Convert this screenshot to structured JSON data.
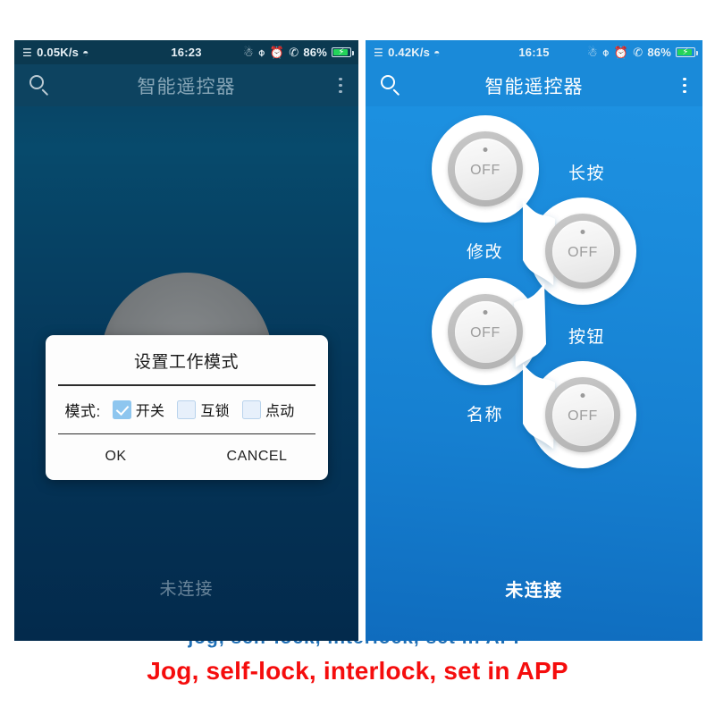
{
  "caption": {
    "text": "Jog, self-lock, interlock, set in APP",
    "color": "#f50d0d"
  },
  "clipped_text": {
    "text": "jog, self-lock, interlock, set in APP"
  },
  "phones": {
    "left": {
      "status_bar": {
        "network_speed": "0.05K/s",
        "signal_icon": "signal-bars-icon",
        "wifi_icon": "wifi-icon",
        "time": "16:23",
        "bluetooth_icon": "bluetooth-icon",
        "mute_icon": "mute-icon",
        "alarm_icon": "alarm-icon",
        "call_icon": "call-sound-icon",
        "battery_percent": "86%",
        "battery_icon": "battery-charging-icon"
      },
      "app_bar": {
        "search_icon": "search-icon",
        "title": "智能遥控器",
        "overflow_icon": "overflow-menu-icon"
      },
      "dialog": {
        "title": "设置工作模式",
        "field_label": "模式:",
        "options": [
          {
            "label": "开关",
            "checked": true
          },
          {
            "label": "互锁",
            "checked": false
          },
          {
            "label": "点动",
            "checked": false
          }
        ],
        "ok_label": "OK",
        "cancel_label": "CANCEL"
      },
      "connection_status": "未连接"
    },
    "right": {
      "status_bar": {
        "network_speed": "0.42K/s",
        "signal_icon": "signal-bars-icon",
        "wifi_icon": "wifi-icon",
        "time": "16:15",
        "bluetooth_icon": "bluetooth-icon",
        "mute_icon": "mute-icon",
        "alarm_icon": "alarm-icon",
        "call_icon": "call-sound-icon",
        "battery_percent": "86%",
        "battery_icon": "battery-charging-icon"
      },
      "app_bar": {
        "search_icon": "search-icon",
        "title": "智能遥控器",
        "overflow_icon": "overflow-menu-icon"
      },
      "buttons": [
        {
          "state": "OFF"
        },
        {
          "state": "OFF"
        },
        {
          "state": "OFF"
        },
        {
          "state": "OFF"
        }
      ],
      "labels": [
        {
          "text": "长按"
        },
        {
          "text": "修改"
        },
        {
          "text": "按钮"
        },
        {
          "text": "名称"
        }
      ],
      "connection_status": "未连接"
    }
  }
}
